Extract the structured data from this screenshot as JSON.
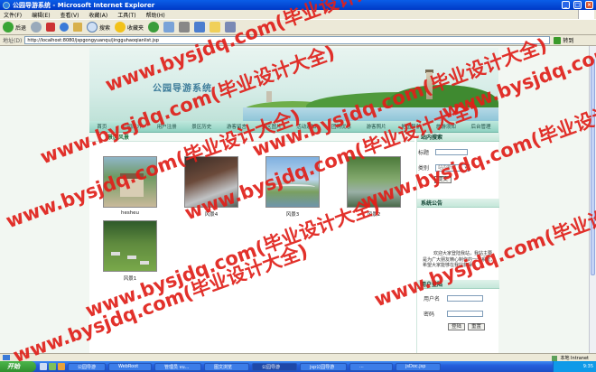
{
  "window": {
    "title": "公园导游系统 - Microsoft Internet Explorer"
  },
  "menu": [
    "文件(F)",
    "编辑(E)",
    "查看(V)",
    "收藏(A)",
    "工具(T)",
    "帮助(H)"
  ],
  "toolbar": {
    "back": "后退",
    "search": "搜索",
    "favorites": "收藏夹"
  },
  "address": {
    "label": "地址(D)",
    "url": "http://localhost:8080/jspgongyuanqu/jingguhaoqianlist.jsp",
    "go": "转到"
  },
  "site": {
    "title": "公园导游系统",
    "nav": [
      "首页",
      "公园简介",
      "用户注册",
      "景区历史",
      "游客留言",
      "景区图片",
      "活动通知",
      "团购优惠",
      "游客照片",
      "地图导航",
      "旅游须知",
      "后台管理"
    ]
  },
  "main": {
    "heading": "景区风景",
    "images": [
      {
        "caption": "hesheu"
      },
      {
        "caption": "风景4"
      },
      {
        "caption": "风景3"
      },
      {
        "caption": "风景2"
      },
      {
        "caption": "风景1"
      }
    ]
  },
  "sidebar": {
    "search": {
      "heading": "站内搜索",
      "title_label": "标题",
      "type_label": "类别",
      "type_value": "站内新闻",
      "submit": "提交"
    },
    "notice": {
      "heading": "系统公告",
      "text": "欢迎大家登陆我站，我站主要是为广大朋友精心制作的一个系统，希望大家能够在我站获得"
    },
    "login": {
      "heading": "用户登陆",
      "username_label": "用户名",
      "password_label": "密码",
      "login_button": "登陆",
      "reset_button": "重置"
    }
  },
  "status": {
    "zone": "本地 Intranet"
  },
  "taskbar": {
    "start": "开始",
    "tasks": [
      "公园导游",
      "WebRoot",
      "管理员 vu...",
      "图文浏览",
      "公园导游",
      "jsp公园导游",
      "...",
      "jsDoc.jsp"
    ],
    "clock": "9:35"
  },
  "watermark": "www.bysjdq.com(毕业设计大全)"
}
